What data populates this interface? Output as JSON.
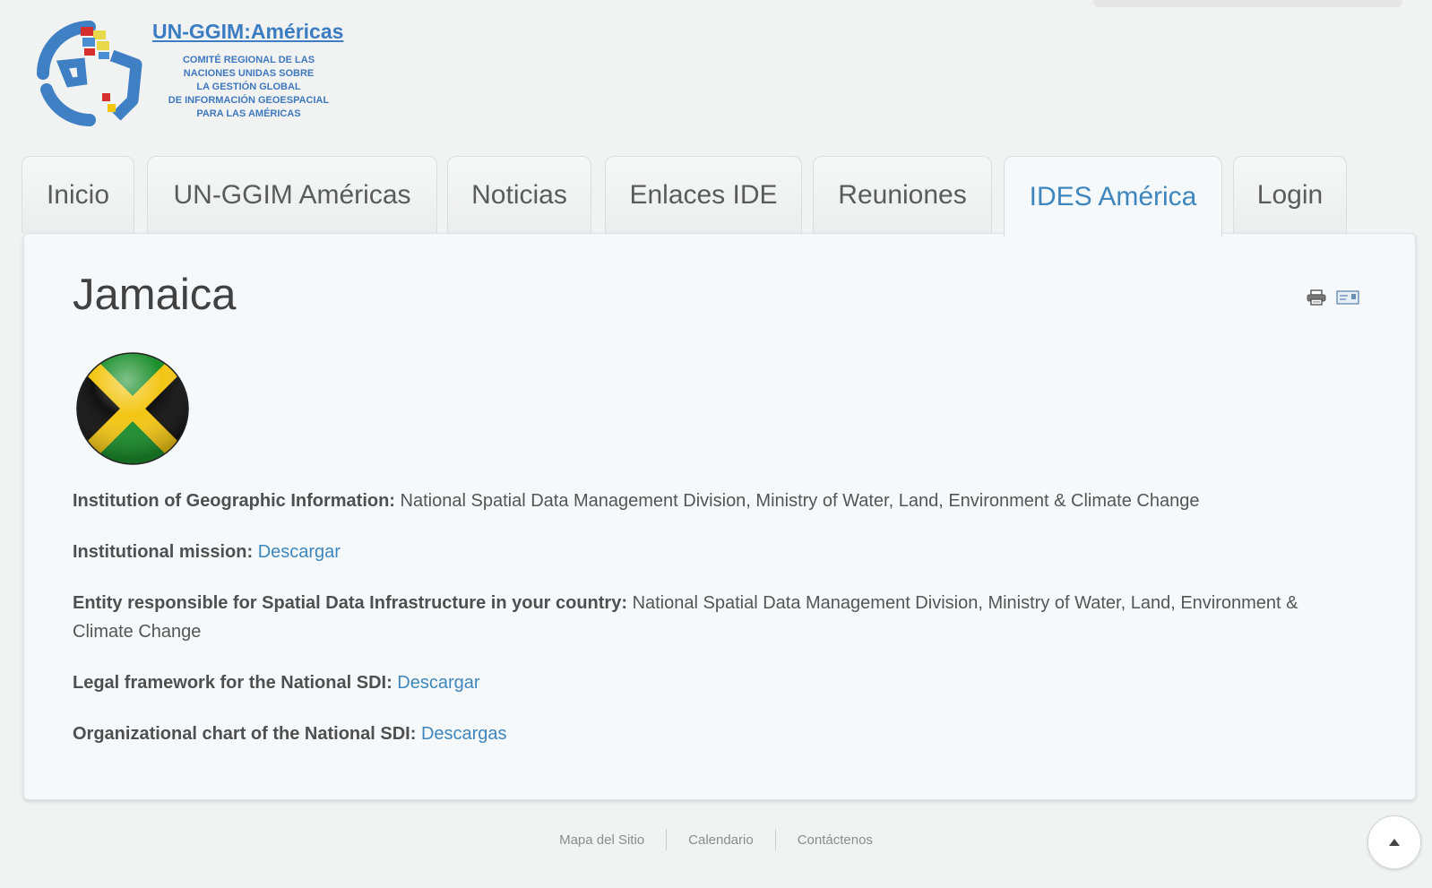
{
  "logo": {
    "title": "UN-GGIM:Américas",
    "subtitle_lines": [
      "COMITÉ REGIONAL DE LAS",
      "NACIONES UNIDAS SOBRE",
      "LA GESTIÓN GLOBAL",
      "DE INFORMACIÓN GEOESPACIAL",
      "PARA LAS AMÉRICAS"
    ]
  },
  "nav": {
    "tabs": [
      {
        "label": "Inicio"
      },
      {
        "label": "UN-GGIM Américas"
      },
      {
        "label": "Noticias"
      },
      {
        "label": "Enlaces IDE"
      },
      {
        "label": "Reuniones"
      },
      {
        "label": "IDES América",
        "active": true
      },
      {
        "label": "Login"
      }
    ]
  },
  "article": {
    "title": "Jamaica",
    "fields": [
      {
        "label": "Institution of Geographic Information:",
        "value": "National Spatial Data Management Division, Ministry of Water, Land, Environment & Climate Change"
      },
      {
        "label": "Institutional mission:",
        "link": "Descargar"
      },
      {
        "label": "Entity responsible for Spatial Data Infrastructure in your country:",
        "value": "National Spatial Data Management Division, Ministry of Water, Land, Environment & Climate Change"
      },
      {
        "label": "Legal framework for the National SDI:",
        "link": "Descargar"
      },
      {
        "label": "Organizational chart of the National SDI:",
        "link": "Descargas"
      }
    ]
  },
  "footer": {
    "links": [
      "Mapa del Sitio",
      "Calendario",
      "Contáctenos"
    ]
  },
  "icons": {
    "print": "print-icon",
    "email": "email-icon",
    "back_to_top": "chevron-up-icon"
  },
  "colors": {
    "link": "#3e86bd",
    "logo_blue": "#3b7cc2",
    "flag_green": "#1a8f2c",
    "flag_gold": "#f3c614"
  }
}
